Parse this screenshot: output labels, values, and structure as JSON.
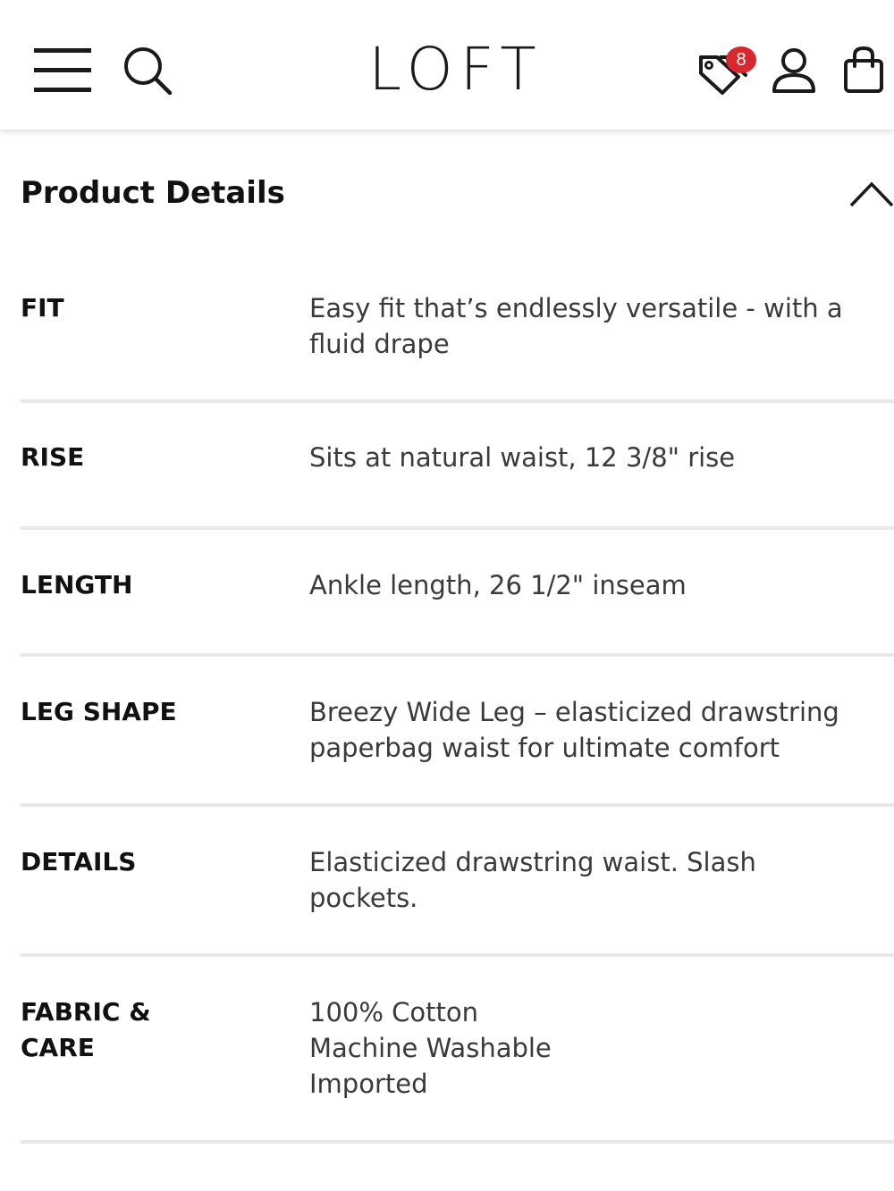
{
  "header": {
    "logo_text": "LOFT",
    "menu_icon": "hamburger-menu-icon",
    "search_icon": "search-icon",
    "tags_icon": "price-tags-icon",
    "tags_badge_count": "8",
    "account_icon": "user-account-icon",
    "bag_icon": "shopping-bag-icon",
    "badge_color": "#d7282f"
  },
  "product_details": {
    "title": "Product Details",
    "toggle_icon": "chevron-up-icon",
    "rows": [
      {
        "label": [
          "FIT"
        ],
        "value": [
          "Easy fit that’s endlessly versatile - with a",
          "fluid drape"
        ]
      },
      {
        "label": [
          "RISE"
        ],
        "value": [
          "Sits at natural waist, 12 3/8\" rise"
        ]
      },
      {
        "label": [
          "LENGTH"
        ],
        "value": [
          "Ankle length, 26 1/2\" inseam"
        ]
      },
      {
        "label": [
          "LEG SHAPE"
        ],
        "value": [
          "Breezy Wide Leg – elasticized drawstring",
          "paperbag waist for ultimate comfort"
        ]
      },
      {
        "label": [
          "DETAILS"
        ],
        "value": [
          "Elasticized drawstring waist. Slash",
          "pockets."
        ]
      },
      {
        "label": [
          "FABRIC &",
          "CARE"
        ],
        "value": [
          "100% Cotton",
          "Machine Washable",
          "Imported"
        ]
      }
    ]
  }
}
